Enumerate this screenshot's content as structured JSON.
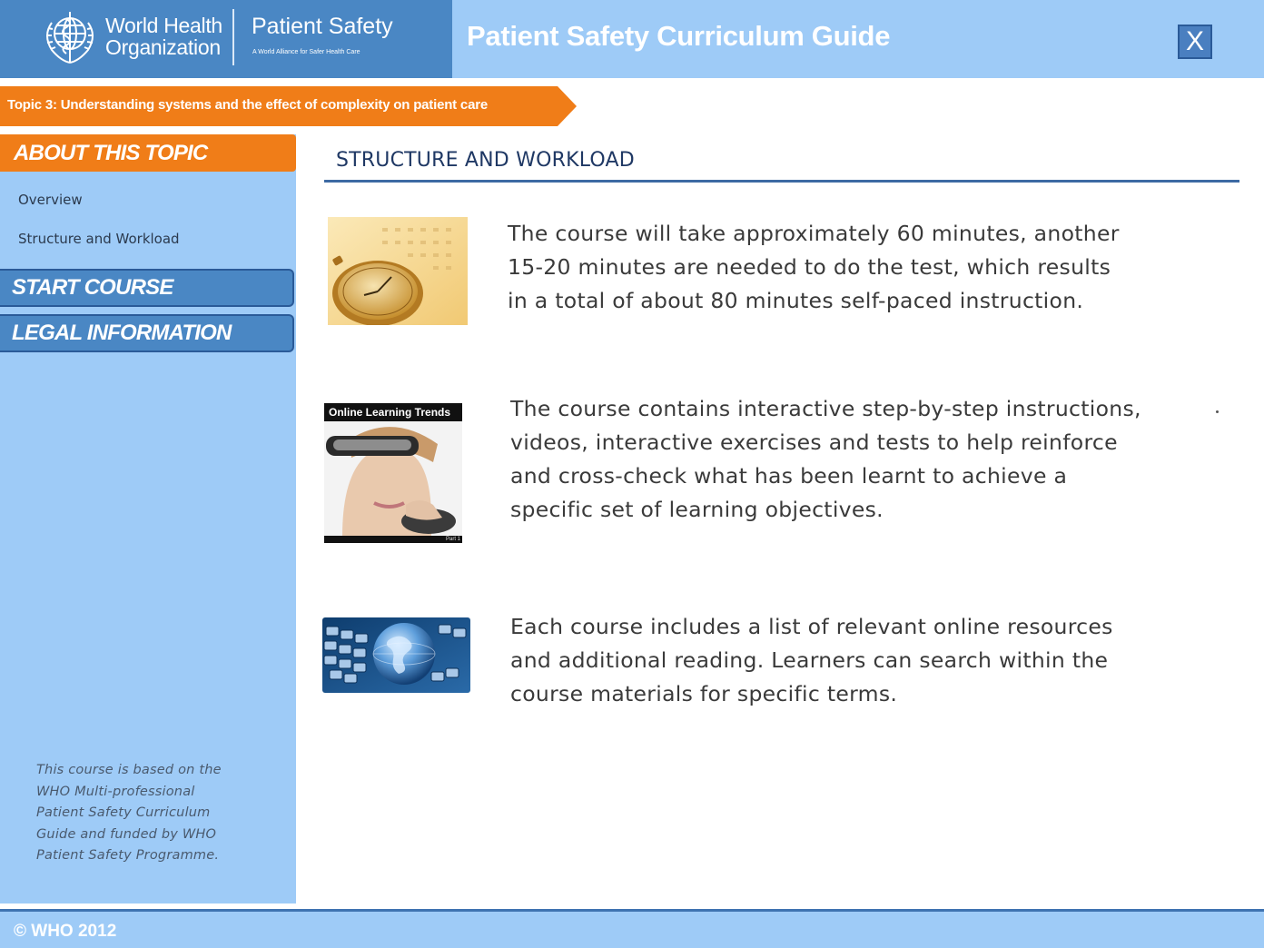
{
  "header": {
    "org_name_line1": "World Health",
    "org_name_line2": "Organization",
    "brand_title": "Patient Safety",
    "brand_subtitle": "A World Alliance for Safer Health Care",
    "app_title": "Patient Safety Curriculum Guide",
    "close_label": "X"
  },
  "topic": {
    "label": "Topic 3: Understanding systems and the effect of complexity on patient care"
  },
  "sidebar": {
    "about_heading": "ABOUT THIS TOPIC",
    "links": [
      {
        "label": "Overview"
      },
      {
        "label": "Structure and Workload"
      }
    ],
    "start_course_label": "START COURSE",
    "legal_label": "LEGAL INFORMATION",
    "note_lines": [
      "This course is based on the",
      "WHO Multi-professional",
      "Patient Safety Curriculum",
      "Guide and funded by WHO",
      "Patient Safety  Programme."
    ]
  },
  "main": {
    "section_title": "STRUCTURE AND WORKLOAD",
    "items": [
      {
        "icon": "stopwatch-calendar-image",
        "lines": [
          "The course will take approximately 60 minutes, another",
          "15-20 minutes are needed to do the test, which results",
          "in a total of about 80 minutes self-paced instruction."
        ]
      },
      {
        "icon": "online-learning-video-image",
        "thumb_caption": "Online Learning Trends",
        "thumb_tag": "Part 1",
        "lines": [
          "The course contains interactive step-by-step instructions,",
          "videos, interactive exercises and tests to help reinforce",
          "and cross-check what has been learnt to achieve a",
          "specific set of learning objectives."
        ]
      },
      {
        "icon": "keyboard-globe-image",
        "lines": [
          "Each course includes a list of relevant online resources",
          "and additional reading. Learners can search within the",
          "course materials for specific terms."
        ]
      }
    ]
  },
  "footer": {
    "copyright": "© WHO 2012"
  },
  "colors": {
    "header_light_blue": "#9ecbf7",
    "brand_blue": "#4a87c4",
    "accent_orange": "#f07d18",
    "title_navy": "#1f3864"
  }
}
